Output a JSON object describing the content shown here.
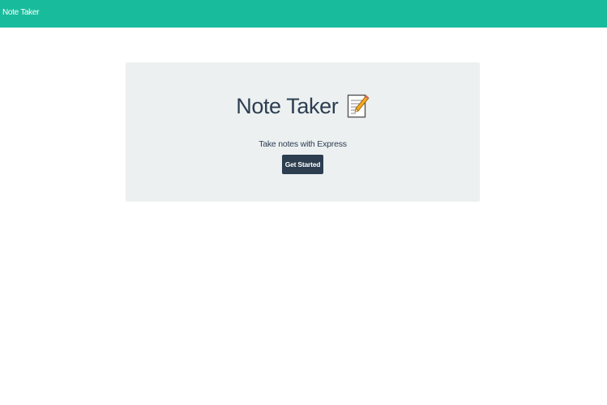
{
  "navbar": {
    "brand": "Note Taker",
    "background": "#18bc9c"
  },
  "hero": {
    "title": "Note Taker",
    "title_icon": "memo-icon",
    "subtitle": "Take notes with Express",
    "cta_label": "Get Started",
    "background": "#ecf0f1"
  },
  "colors": {
    "accent": "#18bc9c",
    "primary": "#2c3e50"
  }
}
